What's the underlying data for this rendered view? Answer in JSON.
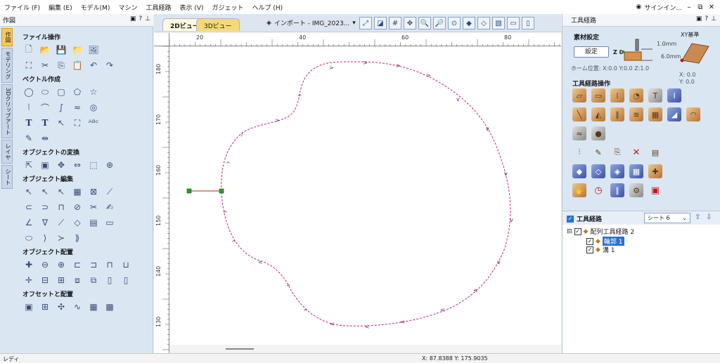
{
  "menu": {
    "items": [
      "ファイル (F)",
      "編集 (E)",
      "モデル(M)",
      "マシン",
      "工具経路",
      "表示 (V)",
      "ガジェット",
      "ヘルプ (H)"
    ],
    "user": "サインイン..."
  },
  "left_panel": {
    "title": "作図",
    "vtabs": [
      "作図",
      "モデリング",
      "3Dクリップアート",
      "レイヤ",
      "シート"
    ],
    "sections": {
      "file_ops": "ファイル操作",
      "vector_create": "ベクトル作成",
      "transform": "オブジェクトの変換",
      "edit": "オブジェクト編集",
      "align": "オブジェクト配置",
      "offset": "オフセットと配置"
    }
  },
  "center": {
    "tab_2d": "2Dビュー",
    "tab_3d": "3Dビュー",
    "import_label": "インポート - IMG_2023...",
    "ruler_top": [
      "20",
      "40",
      "60",
      "80"
    ],
    "ruler_left": [
      "180",
      "170",
      "160",
      "150",
      "140",
      "130"
    ]
  },
  "right_panel": {
    "title": "工具経路",
    "material_title": "素材設定",
    "material_button": "設定",
    "z_label": "Z 0",
    "dim_top": "1.0mm",
    "dim_bottom": "6.0mm",
    "xy_title": "XY基準",
    "xy_x": "X: 0.0",
    "xy_y": "Y: 0.0",
    "home": "ホーム位置: X:0.0 Y:0.0 Z:1.0",
    "ops_title": "工具経路操作",
    "tree_title": "工具経路",
    "sheet": "シート 6",
    "tree": {
      "root": "配列工具経路 2",
      "child1": "輪郭 1",
      "child2": "溝 1"
    }
  },
  "status": {
    "left": "レディ",
    "coords": "X: 87.8388 Y: 175.9035"
  }
}
